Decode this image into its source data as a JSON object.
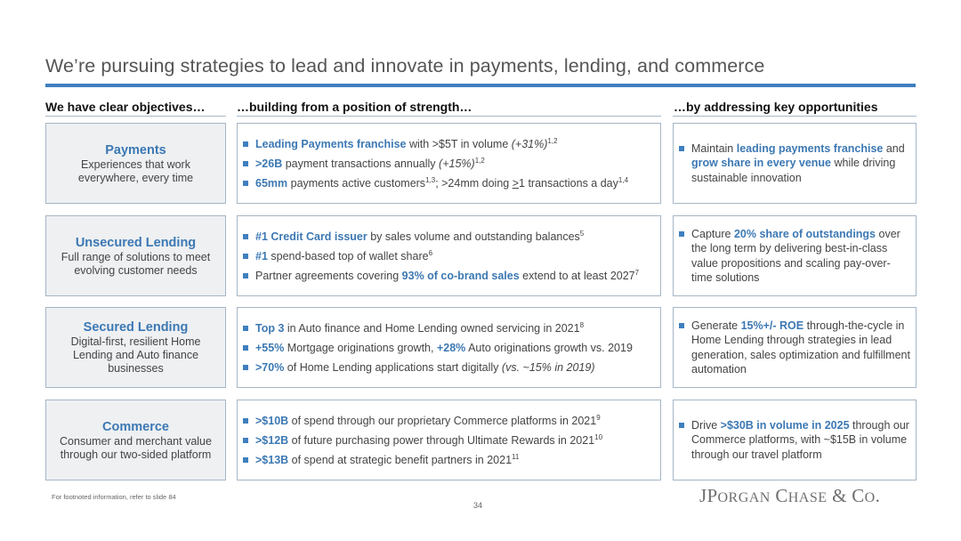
{
  "title": "We’re pursuing strategies to lead and innovate in payments, lending, and commerce",
  "column_headers": {
    "objectives": "We have clear objectives…",
    "strength": "…building from a position of strength…",
    "opportunities": "…by addressing key opportunities"
  },
  "colors": {
    "accent": "#3f7fbf",
    "highlight": "#3c78b3",
    "box_border": "#a5b6c6",
    "objective_bg": "#eef0f2"
  },
  "rows": [
    {
      "objective": {
        "title": "Payments",
        "desc": "Experiences that work everywhere, every time"
      },
      "strengths": [
        {
          "hl": "Leading Payments franchise",
          "t1": " with >$5T in volume ",
          "it": "(+31%)",
          "sup": "1,2"
        },
        {
          "hl": ">26B",
          "t1": " payment transactions annually ",
          "it": "(+15%)",
          "sup": "1,2"
        },
        {
          "hl": "65mm",
          "t1": " payments active customers",
          "sup1": "1,3",
          "t2": "; >24mm doing ",
          "und": ">",
          "t3": "1 transactions a day",
          "sup": "1,4"
        }
      ],
      "opportunity": {
        "t1": "Maintain ",
        "hl1": "leading payments franchise",
        "t2": " and ",
        "hl2": "grow share in every venue",
        "t3": " while driving sustainable innovation"
      }
    },
    {
      "objective": {
        "title": "Unsecured Lending",
        "desc": "Full range of solutions to meet evolving customer needs"
      },
      "strengths": [
        {
          "hl": "#1 Credit Card issuer",
          "t1": " by sales volume and outstanding balances",
          "sup": "5"
        },
        {
          "hl": "#1",
          "t1": " spend-based top of wallet share",
          "sup": "6"
        },
        {
          "t0": "Partner agreements covering ",
          "hl": "93% of co-brand sales",
          "t1": " extend to at least 2027",
          "sup": "7"
        }
      ],
      "opportunity": {
        "t1": "Capture ",
        "hl1": "20% share of outstandings",
        "t2": " over the long term by delivering best-in-class value propositions and scaling pay-over-time solutions"
      }
    },
    {
      "objective": {
        "title": "Secured Lending",
        "desc": "Digital-first, resilient Home Lending and Auto finance businesses"
      },
      "strengths": [
        {
          "hl": "Top 3",
          "t1": " in Auto finance and Home Lending owned servicing in 2021",
          "sup": "8"
        },
        {
          "hl": "+55%",
          "t1": " Mortgage originations growth, ",
          "hl2": "+28%",
          "t2": " Auto originations growth vs. 2019"
        },
        {
          "hl": ">70%",
          "t1": " of Home Lending applications start digitally ",
          "it": "(vs. ~15% in 2019)"
        }
      ],
      "opportunity": {
        "t1": "Generate ",
        "hl1": "15%+/- ROE",
        "t2": " through-the-cycle in Home Lending through strategies in lead generation, sales optimization and fulfillment automation"
      }
    },
    {
      "objective": {
        "title": "Commerce",
        "desc": "Consumer and merchant value through our two-sided platform"
      },
      "strengths": [
        {
          "hl": ">$10B",
          "t1": " of spend through our proprietary Commerce platforms in 2021",
          "sup": "9"
        },
        {
          "hl": ">$12B",
          "t1": " of future purchasing power through Ultimate Rewards in 2021",
          "sup": "10"
        },
        {
          "hl": ">$13B",
          "t1": " of spend at strategic benefit partners in 2021",
          "sup": "11"
        }
      ],
      "opportunity": {
        "t1": "Drive ",
        "hl1": ">$30B in volume in 2025",
        "t2": " through our Commerce platforms, with ~$15B in volume through our travel platform"
      }
    }
  ],
  "footnote": "For footnoted information, refer to slide 84",
  "page_number": "34",
  "logo": {
    "j": "J",
    "p": "P",
    "organ": "ORGAN",
    "c": "C",
    "hase": "HASE",
    "amp_co": " & C",
    "o": "O",
    "dot": "."
  }
}
